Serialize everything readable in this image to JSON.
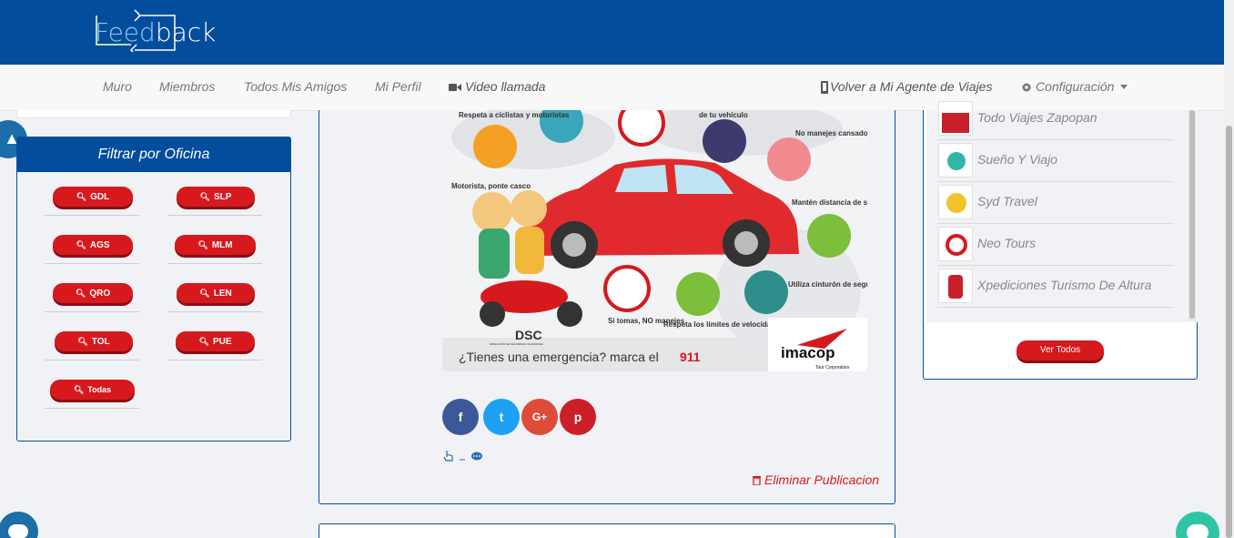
{
  "brand": {
    "logo_text_a": "Feed",
    "logo_text_b": "back"
  },
  "nav": {
    "items": [
      "Muro",
      "Miembros",
      "Todos Mis Amigos",
      "Mi Perfil"
    ],
    "video": "Video llamada",
    "agent": "Volver a Mi Agente de Viajes",
    "config": "Configuración"
  },
  "filter": {
    "title": "Filtrar por Oficina",
    "offices": [
      "GDL",
      "SLP",
      "AGS",
      "MLM",
      "QRO",
      "LEN",
      "TOL",
      "PUE",
      "Todas"
    ]
  },
  "post": {
    "infographic": {
      "labels": [
        "Respeta a ciclistas y motoristas",
        "de tu vehículo",
        "No manejes cansado",
        "Motorista, ponte casco",
        "Mantén distancia de seguridad",
        "Si tomas, NO manejes",
        "Respeta los límites de velocidad",
        "Utiliza cinturón de seguridad",
        "DSC",
        "DIRECCIÓN DE SEGURIDAD CIUDADANA",
        "¿Tienes una emergencia? marca el",
        "911",
        "imacop",
        "Tour Corporation"
      ]
    },
    "share": {
      "facebook": "f",
      "twitter": "t",
      "googleplus": "G+",
      "pinterest": "p"
    },
    "delete": "Eliminar Publicacion"
  },
  "agencies": {
    "items": [
      "Todo Viajes Zapopan",
      "Sueño Y Viajo",
      "Syd Travel",
      "Neo Tours",
      "Xpediciones Turismo De Altura"
    ],
    "ver_todos": "Ver Todos"
  },
  "colors": {
    "header_blue": "#044d9c",
    "button_red": "#d6191d",
    "facebook": "#3b5998",
    "twitter": "#1da1f2",
    "googleplus": "#dd4b39",
    "pinterest": "#cb2027"
  }
}
